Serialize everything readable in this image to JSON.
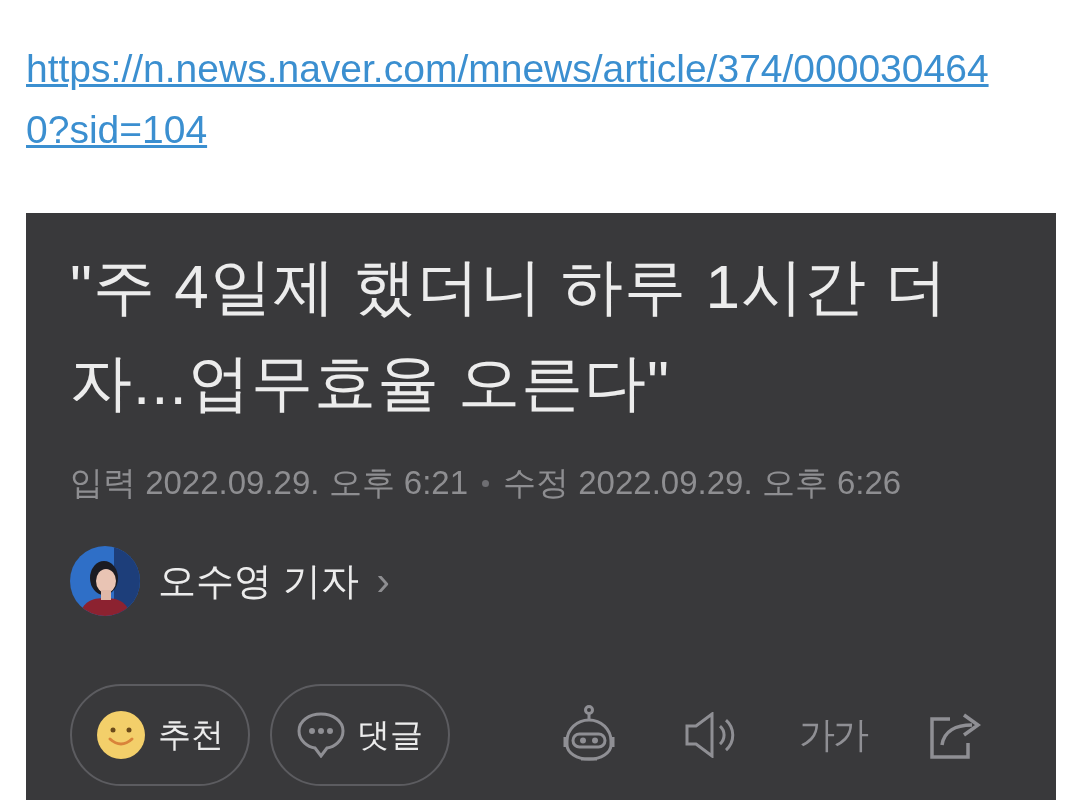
{
  "link": {
    "text": "https://n.news.naver.com/mnews/article/374/0000304640?sid=104"
  },
  "article": {
    "title": "\"주 4일제 했더니 하루 1시간 더 자...업무효율 오른다\"",
    "published": "입력 2022.09.29. 오후 6:21",
    "modified": "수정 2022.09.29. 오후 6:26",
    "author": {
      "name": "오수영 기자",
      "chevron": "›"
    },
    "actions": [
      {
        "kind": "like",
        "label": "추천"
      },
      {
        "kind": "comment",
        "label": "댓글"
      }
    ],
    "tools": [
      {
        "kind": "bot"
      },
      {
        "kind": "speaker"
      },
      {
        "kind": "font",
        "label": "가가"
      },
      {
        "kind": "share"
      }
    ]
  }
}
